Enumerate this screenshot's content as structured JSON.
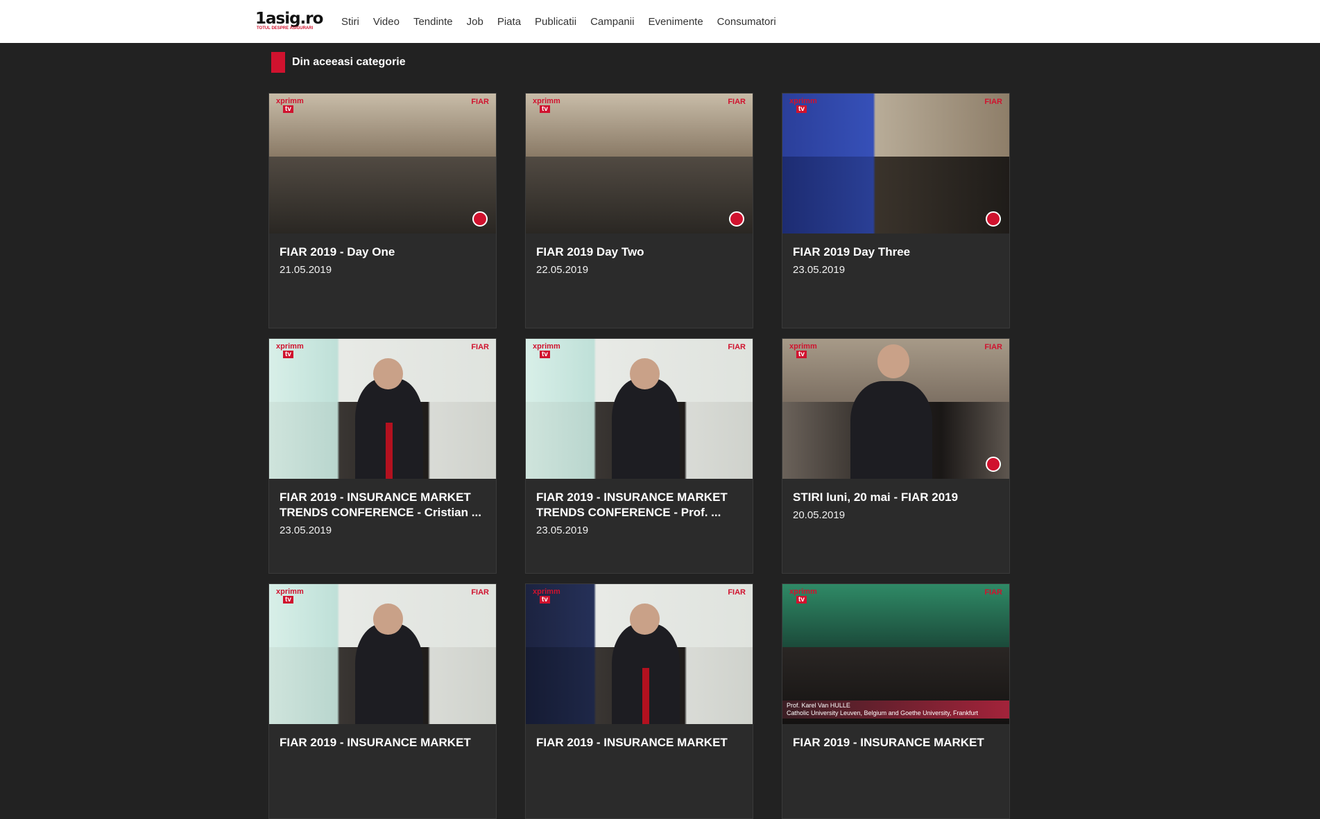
{
  "logo": {
    "main": "1asig.ro",
    "tagline": "TOTUL DESPRE ASIGURARI"
  },
  "nav": [
    "Stiri",
    "Video",
    "Tendinte",
    "Job",
    "Piata",
    "Publicatii",
    "Campanii",
    "Evenimente",
    "Consumatori"
  ],
  "section": {
    "title": "Din aceeasi categorie"
  },
  "cards": [
    {
      "title": "FIAR 2019 - Day One",
      "date": "21.05.2019",
      "scene": "hall"
    },
    {
      "title": "FIAR 2019 Day Two",
      "date": "22.05.2019",
      "scene": "hall"
    },
    {
      "title": "FIAR 2019 Day Three",
      "date": "23.05.2019",
      "scene": "screen"
    },
    {
      "title": "FIAR 2019 - INSURANCE MARKET TRENDS CONFERENCE - Cristian ...",
      "date": "23.05.2019",
      "scene": "stage"
    },
    {
      "title": "FIAR 2019 - INSURANCE MARKET TRENDS CONFERENCE - Prof. ...",
      "date": "23.05.2019",
      "scene": "stage"
    },
    {
      "title": "STIRI luni, 20 mai - FIAR 2019",
      "date": "20.05.2019",
      "scene": "report"
    },
    {
      "title": "FIAR 2019 - INSURANCE MARKET",
      "date": "",
      "scene": "stage"
    },
    {
      "title": "FIAR 2019 - INSURANCE MARKET",
      "date": "",
      "scene": "stage"
    },
    {
      "title": "FIAR 2019 - INSURANCE MARKET",
      "date": "",
      "scene": "panel",
      "lowerthird": [
        "Prof. Karel Van HULLE",
        "Catholic University Leuven, Belgium and Goethe University, Frankfurt"
      ]
    }
  ],
  "thumb_brand": {
    "left": "xprimm",
    "tv": "tv",
    "right": "FIAR"
  },
  "colors": {
    "accent": "#d0122e",
    "background": "#222222",
    "card": "#2b2b2b",
    "header": "#ffffff"
  }
}
